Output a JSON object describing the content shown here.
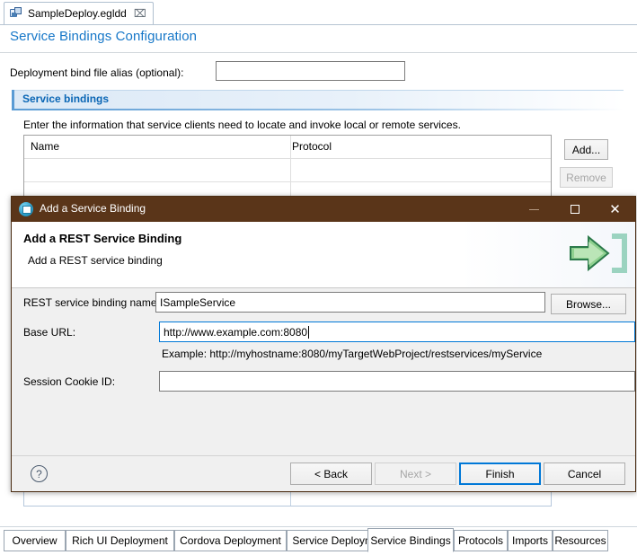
{
  "editor": {
    "tab": {
      "label": "SampleDeploy.egldd",
      "close": "⌧",
      "icon": "deployment-descriptor-icon"
    },
    "form_title": "Service Bindings Configuration",
    "alias": {
      "label": "Deployment bind file alias (optional):",
      "value": "",
      "placeholder": ""
    },
    "section": {
      "title": "Service bindings",
      "description": "Enter the information that service clients need to locate and invoke local or remote services."
    },
    "table": {
      "columns": [
        "Name",
        "Protocol"
      ],
      "rows": []
    },
    "buttons": {
      "add": "Add...",
      "remove": "Remove"
    },
    "bottom_tabs": [
      {
        "label": "Overview",
        "active": false
      },
      {
        "label": "Rich UI Deployment",
        "active": false
      },
      {
        "label": "Cordova Deployment",
        "active": false
      },
      {
        "label": "Service Deployment",
        "active": false
      },
      {
        "label": "Service Bindings",
        "active": true
      },
      {
        "label": "Protocols",
        "active": false
      },
      {
        "label": "Imports",
        "active": false
      },
      {
        "label": "Resources",
        "active": false
      }
    ]
  },
  "dialog": {
    "title": "Add a Service Binding",
    "window_controls": {
      "minimize": "—",
      "maximize": "□",
      "close": "✕"
    },
    "heading": "Add a REST Service Binding",
    "subheading": "Add a REST service binding",
    "fields": [
      {
        "label": "REST service binding name:",
        "value": "ISampleService",
        "focused": false
      },
      {
        "label": "Base URL:",
        "value": "http://www.example.com:8080",
        "focused": true
      },
      {
        "label": "Session Cookie ID:",
        "value": "",
        "focused": false
      }
    ],
    "hint": "Example: http://myhostname:8080/myTargetWebProject/restservices/myService",
    "browse_label": "Browse...",
    "help_label": "?",
    "footer_buttons": [
      {
        "label": "< Back",
        "enabled": true,
        "default": false
      },
      {
        "label": "Next >",
        "enabled": false,
        "default": false
      },
      {
        "label": "Finish",
        "enabled": true,
        "default": true
      },
      {
        "label": "Cancel",
        "enabled": true,
        "default": false
      }
    ]
  },
  "colors": {
    "titlebar": "#5a3519",
    "form_title": "#1677c8",
    "section_title": "#0a66b5",
    "focus": "#0078d7",
    "wizard_green": "#6ab04c"
  }
}
